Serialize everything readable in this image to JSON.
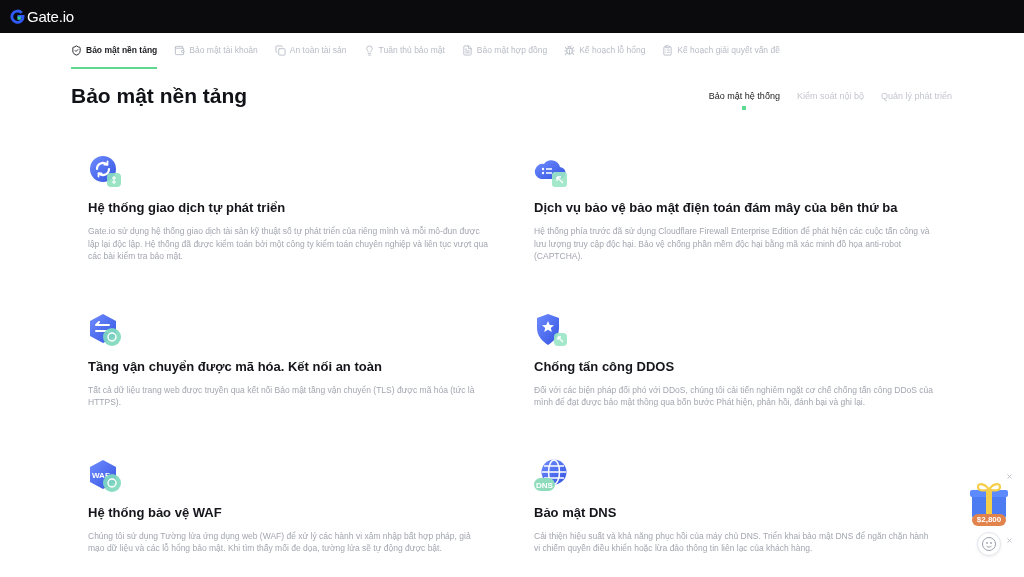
{
  "header": {
    "logo": "Gate.io"
  },
  "tabs": [
    {
      "label": "Bảo mật nền tảng",
      "selected": true
    },
    {
      "label": "Bảo mật tài khoản",
      "selected": false
    },
    {
      "label": "An toàn tài sản",
      "selected": false
    },
    {
      "label": "Tuân thủ bảo mật",
      "selected": false
    },
    {
      "label": "Bảo mật hợp đồng",
      "selected": false
    },
    {
      "label": "Kế hoạch lỗ hổng",
      "selected": false
    },
    {
      "label": "Kế hoạch giải quyết vấn đề",
      "selected": false
    }
  ],
  "page_title": "Bảo mật nền tảng",
  "subtabs": [
    {
      "label": "Bảo mật hệ thống",
      "selected": true
    },
    {
      "label": "Kiểm soát nội bộ",
      "selected": false
    },
    {
      "label": "Quản lý phát triển",
      "selected": false
    }
  ],
  "features": [
    {
      "title": "Hệ thống giao dịch tự phát triển",
      "description": "Gate.io sử dụng hệ thống giao dịch tài sản kỹ thuật số tự phát triển của riêng mình và mỗi mô-đun được lập lại độc lập. Hệ thống đã được kiểm toán bởi một công ty kiểm toán chuyên nghiệp và liên tục vượt qua các bài kiểm tra bảo mật."
    },
    {
      "title": "Dịch vụ bảo vệ bảo mật điện toán đám mây của bên thứ ba",
      "description": "Hệ thống phía trước đã sử dụng Cloudflare Firewall Enterprise Edition để phát hiện các cuộc tấn công và lưu lượng truy cập độc hại. Bảo vệ chống phần mềm độc hại bằng mã xác minh đồ họa anti-robot (CAPTCHA)."
    },
    {
      "title": "Tầng vận chuyển được mã hóa. Kết nối an toàn",
      "description": "Tất cả dữ liệu trang web được truyền qua kết nối Bảo mật tầng vận chuyển (TLS) được mã hóa (tức là HTTPS)."
    },
    {
      "title": "Chống tấn công DDOS",
      "description": "Đối với các biện pháp đối phó với DDoS, chúng tôi cải tiến nghiêm ngặt cơ chế chống tấn công DDoS của mình để đạt được bảo mật thông qua bốn bước Phát hiện, phản hồi, đánh bại và ghi lại."
    },
    {
      "title": "Hệ thống bảo vệ WAF",
      "description": "Chúng tôi sử dụng Tường lửa ứng dụng web (WAF) để xử lý các hành vi xâm nhập bất hợp pháp, giả mạo dữ liệu và các lỗ hổng bảo mật. Khi tìm thấy mối đe dọa, tường lửa sẽ tự động được bật.",
      "icon_text": "WAF"
    },
    {
      "title": "Bảo mật DNS",
      "description": "Cải thiện hiệu suất và khả năng phục hồi của máy chủ DNS. Triển khai bảo mật DNS để ngăn chặn hành vi chiếm quyền điều khiển hoặc lừa đảo thông tin liên lạc của khách hàng.",
      "icon_text": "DNS"
    }
  ],
  "promo": {
    "amount": "$2,800"
  }
}
